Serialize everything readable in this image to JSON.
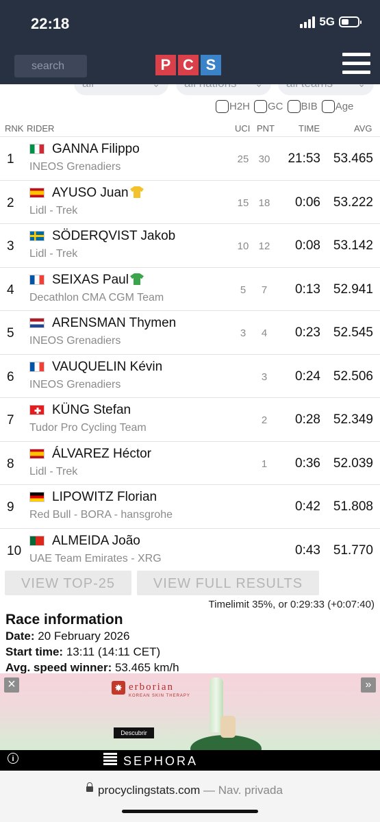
{
  "status_bar": {
    "time": "22:18",
    "network": "5G"
  },
  "header": {
    "search_placeholder": "search",
    "logo_letters": [
      "P",
      "C",
      "S"
    ]
  },
  "filters": {
    "selects": [
      "all",
      "all nations",
      "all teams"
    ],
    "checkboxes": [
      "H2H",
      "GC",
      "BIB",
      "Age"
    ]
  },
  "table": {
    "headers": {
      "rnk": "RNK",
      "rider": "RIDER",
      "uci": "UCI",
      "pnt": "PNT",
      "time": "TIME",
      "avg": "AVG"
    },
    "rows": [
      {
        "rnk": "1",
        "flag": "it",
        "name": "GANNA Filippo",
        "team": "INEOS Grenadiers",
        "uci": "25",
        "pnt": "30",
        "time": "21:53",
        "avg": "53.465",
        "jersey": ""
      },
      {
        "rnk": "2",
        "flag": "es",
        "name": "AYUSO Juan",
        "team": "Lidl - Trek",
        "uci": "15",
        "pnt": "18",
        "time": "0:06",
        "avg": "53.222",
        "jersey": "yellow"
      },
      {
        "rnk": "3",
        "flag": "se",
        "name": "SÖDERQVIST Jakob",
        "team": "Lidl - Trek",
        "uci": "10",
        "pnt": "12",
        "time": "0:08",
        "avg": "53.142",
        "jersey": ""
      },
      {
        "rnk": "4",
        "flag": "fr",
        "name": "SEIXAS Paul",
        "team": "Decathlon CMA CGM Team",
        "uci": "5",
        "pnt": "7",
        "time": "0:13",
        "avg": "52.941",
        "jersey": "green"
      },
      {
        "rnk": "5",
        "flag": "nl",
        "name": "ARENSMAN Thymen",
        "team": "INEOS Grenadiers",
        "uci": "3",
        "pnt": "4",
        "time": "0:23",
        "avg": "52.545",
        "jersey": ""
      },
      {
        "rnk": "6",
        "flag": "fr",
        "name": "VAUQUELIN Kévin",
        "team": "INEOS Grenadiers",
        "uci": "",
        "pnt": "3",
        "time": "0:24",
        "avg": "52.506",
        "jersey": ""
      },
      {
        "rnk": "7",
        "flag": "ch",
        "name": "KÜNG Stefan",
        "team": "Tudor Pro Cycling Team",
        "uci": "",
        "pnt": "2",
        "time": "0:28",
        "avg": "52.349",
        "jersey": ""
      },
      {
        "rnk": "8",
        "flag": "es",
        "name": "ÁLVAREZ Héctor",
        "team": "Lidl - Trek",
        "uci": "",
        "pnt": "1",
        "time": "0:36",
        "avg": "52.039",
        "jersey": ""
      },
      {
        "rnk": "9",
        "flag": "de",
        "name": "LIPOWITZ Florian",
        "team": "Red Bull - BORA - hansgrohe",
        "uci": "",
        "pnt": "",
        "time": "0:42",
        "avg": "51.808",
        "jersey": ""
      },
      {
        "rnk": "10",
        "flag": "pt",
        "name": "ALMEIDA João",
        "team": "UAE Team Emirates - XRG",
        "uci": "",
        "pnt": "",
        "time": "0:43",
        "avg": "51.770",
        "jersey": ""
      }
    ]
  },
  "buttons": {
    "top25": "VIEW TOP-25",
    "full": "VIEW FULL RESULTS"
  },
  "timelimit": "Timelimit 35%, or 0:29:33 (+0:07:40)",
  "race_info": {
    "title": "Race information",
    "date_label": "Date:",
    "date": "20 February 2026",
    "start_label": "Start time:",
    "start": "13:11 (14:11 CET)",
    "speed_label": "Avg. speed winner:",
    "speed": "53.465 km/h"
  },
  "ad": {
    "brand": "erborian",
    "tagline": "KOREAN SKIN THERAPY",
    "cta": "Descubrir",
    "sponsor": "SEPHORA"
  },
  "url_bar": {
    "domain": "procyclingstats.com",
    "suffix": " — Nav. privada"
  },
  "colors": {
    "header_bg": "#283142",
    "logo_red": "#d9404a",
    "logo_blue": "#3b83c8"
  }
}
